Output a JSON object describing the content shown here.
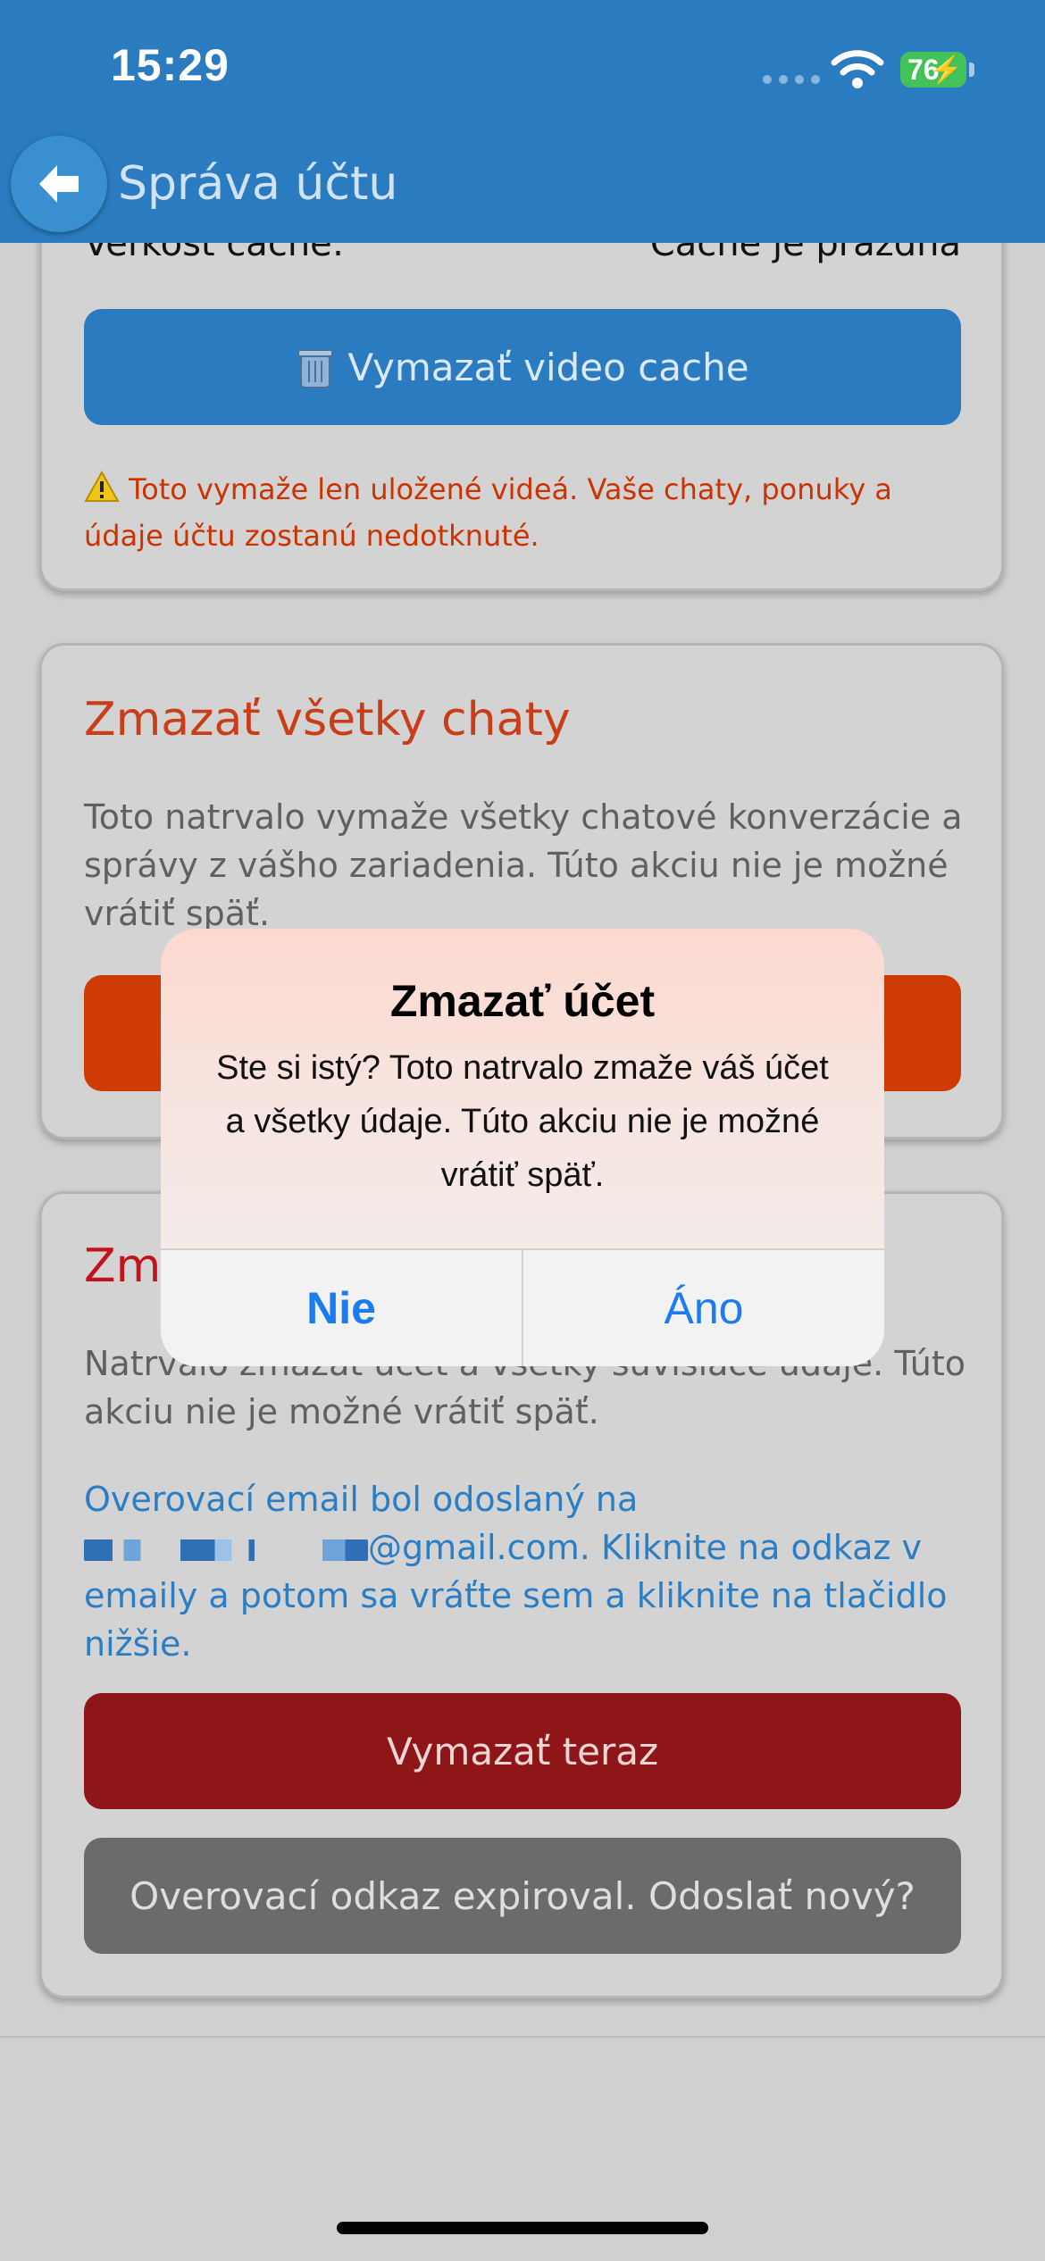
{
  "status_bar": {
    "time": "15:29",
    "battery": "76"
  },
  "header": {
    "title": "Správa účtu"
  },
  "cache_section": {
    "size_label": "Veľkosť cache:",
    "size_value": "Cache je prázdna",
    "clear_button": "Vymazať video cache",
    "warning": "Toto vymaže len uložené videá. Vaše chaty, ponuky a údaje účtu zostanú nedotknuté."
  },
  "chats_section": {
    "title": "Zmazať všetky chaty",
    "description": "Toto natrvalo vymaže všetky chatové konverzácie a správy z vášho zariadenia. Túto akciu nie je možné vrátiť späť."
  },
  "account_section": {
    "title": "Zmazať účet",
    "description": "Natrvalo zmazať účet a všetky súvisiace údaje. Túto akciu nie je možné vrátiť späť.",
    "verify_prefix": "Overovací email bol odoslaný na",
    "verify_email_domain": "@gmail.com.",
    "verify_suffix": "Kliknite na odkaz v emaily a potom sa vráťte sem a kliknite na tlačidlo nižšie.",
    "delete_now_button": "Vymazať teraz",
    "resend_button": "Overovací odkaz expiroval. Odoslať nový?"
  },
  "dialog": {
    "title": "Zmazať účet",
    "message": "Ste si istý? Toto natrvalo zmaže váš účet a všetky údaje. Túto akciu nie je možné vrátiť späť.",
    "cancel": "Nie",
    "confirm": "Áno"
  },
  "colors": {
    "header": "#2a7bbf",
    "primary_button": "#2a7bbf",
    "danger_orange": "#cf3b06",
    "danger_red": "#8e1618",
    "neutral_button": "#6b6b6b",
    "link_blue": "#2b7ec3",
    "ios_blue": "#1a7cf0"
  },
  "icons": {
    "back": "arrow-left-icon",
    "trash": "wastebasket-icon",
    "warning": "warning-triangle-icon",
    "wifi": "wifi-icon",
    "battery": "battery-charging-icon"
  }
}
